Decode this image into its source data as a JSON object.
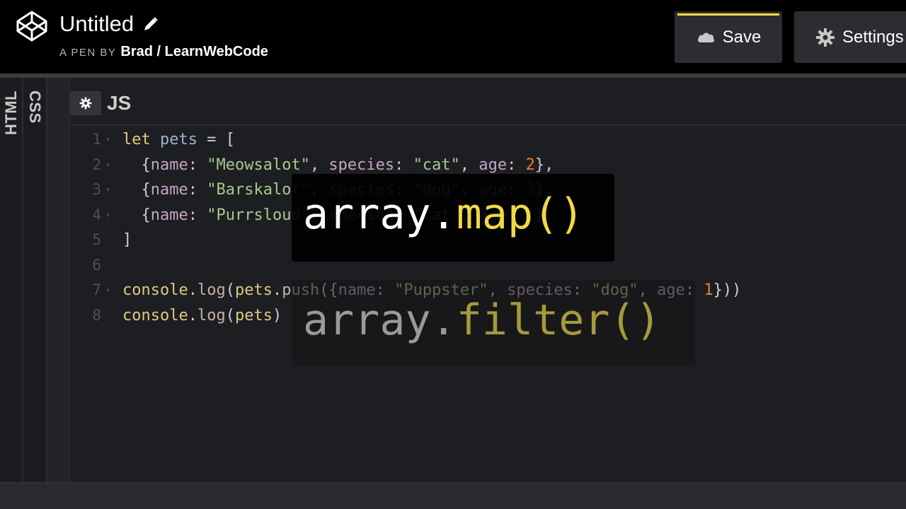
{
  "header": {
    "pen_title": "Untitled",
    "by_label": "A PEN BY",
    "author": "Brad / LearnWebCode",
    "save_label": "Save",
    "settings_label": "Settings",
    "accent_color": "#ffdd40"
  },
  "side_tabs": {
    "html": "HTML",
    "css": "CSS"
  },
  "js_panel": {
    "title": "JS"
  },
  "code_lines": [
    {
      "n": "1",
      "tokens": [
        [
          "kw",
          "let "
        ],
        [
          "var",
          "pets"
        ],
        [
          "punc",
          " = ["
        ]
      ]
    },
    {
      "n": "2",
      "tokens": [
        [
          "punc",
          "  {"
        ],
        [
          "prop",
          "name"
        ],
        [
          "punc",
          ": "
        ],
        [
          "str",
          "\"Meowsalot\""
        ],
        [
          "punc",
          ", "
        ],
        [
          "prop",
          "species"
        ],
        [
          "punc",
          ": "
        ],
        [
          "str",
          "\"cat\""
        ],
        [
          "punc",
          ", "
        ],
        [
          "prop",
          "age"
        ],
        [
          "punc",
          ": "
        ],
        [
          "num",
          "2"
        ],
        [
          "punc",
          "},"
        ]
      ]
    },
    {
      "n": "3",
      "tokens": [
        [
          "punc",
          "  {"
        ],
        [
          "prop",
          "name"
        ],
        [
          "punc",
          ": "
        ],
        [
          "str",
          "\"Barskalot\""
        ],
        [
          "punc",
          ", "
        ],
        [
          "prop",
          "species"
        ],
        [
          "punc",
          ": "
        ],
        [
          "str",
          "\"dog\""
        ],
        [
          "punc",
          ", "
        ],
        [
          "prop",
          "age"
        ],
        [
          "punc",
          ": "
        ],
        [
          "num",
          "3"
        ],
        [
          "punc",
          "},"
        ]
      ]
    },
    {
      "n": "4",
      "tokens": [
        [
          "punc",
          "  {"
        ],
        [
          "prop",
          "name"
        ],
        [
          "punc",
          ": "
        ],
        [
          "str",
          "\"Purrsloud\""
        ],
        [
          "punc",
          ", "
        ],
        [
          "prop",
          "species"
        ],
        [
          "punc",
          ": "
        ],
        [
          "str",
          "\"cat\""
        ],
        [
          "punc",
          ", "
        ],
        [
          "prop",
          "age"
        ],
        [
          "punc",
          ": "
        ],
        [
          "num",
          "1"
        ],
        [
          "punc",
          "}"
        ]
      ]
    },
    {
      "n": "5",
      "tokens": [
        [
          "punc",
          "]"
        ]
      ]
    },
    {
      "n": "6",
      "tokens": []
    },
    {
      "n": "7",
      "tokens": [
        [
          "kw",
          "console"
        ],
        [
          "punc",
          "."
        ],
        [
          "fn",
          "log"
        ],
        [
          "punc",
          "("
        ],
        [
          "kw",
          "pets"
        ],
        [
          "punc",
          "."
        ],
        [
          "fn",
          "push"
        ],
        [
          "punc",
          "({"
        ],
        [
          "prop",
          "name"
        ],
        [
          "punc",
          ": "
        ],
        [
          "str",
          "\"Puppster\""
        ],
        [
          "punc",
          ", "
        ],
        [
          "prop",
          "species"
        ],
        [
          "punc",
          ": "
        ],
        [
          "str",
          "\"dog\""
        ],
        [
          "punc",
          ", "
        ],
        [
          "prop",
          "age"
        ],
        [
          "punc",
          ": "
        ],
        [
          "num",
          "1"
        ],
        [
          "punc",
          "}))"
        ]
      ]
    },
    {
      "n": "8",
      "tokens": [
        [
          "kw",
          "console"
        ],
        [
          "punc",
          "."
        ],
        [
          "fn",
          "log"
        ],
        [
          "punc",
          "("
        ],
        [
          "kw",
          "pets"
        ],
        [
          "punc",
          ")"
        ]
      ]
    }
  ],
  "folds": [
    "1",
    "2",
    "3",
    "4",
    "7"
  ],
  "overlays": {
    "map": {
      "prefix": "array.",
      "method": "map()"
    },
    "filter": {
      "prefix": "array.",
      "method": "filter()"
    }
  }
}
